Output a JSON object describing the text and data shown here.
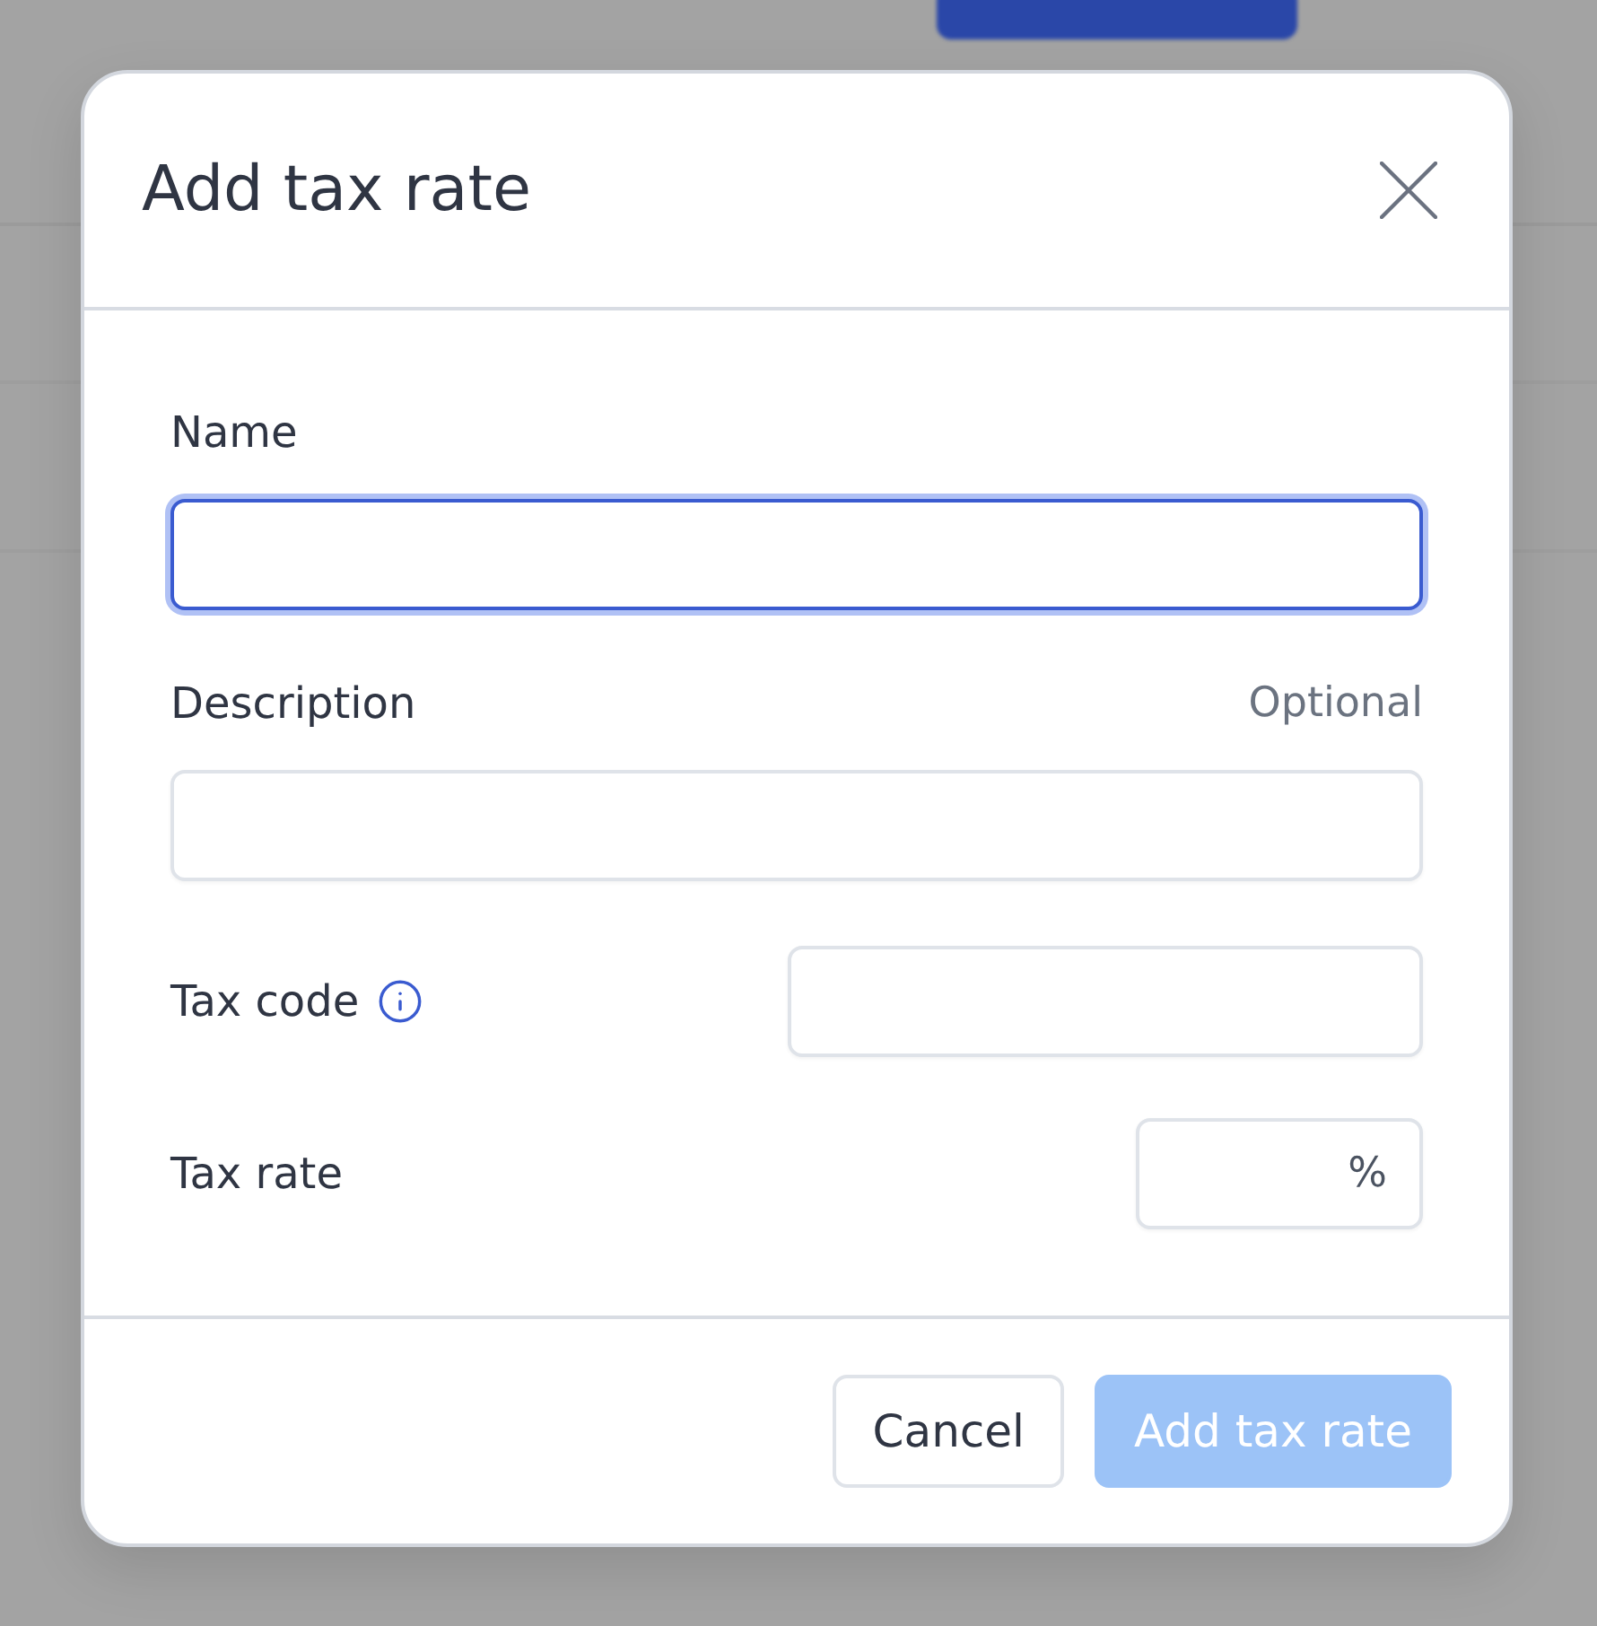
{
  "dialog": {
    "title": "Add tax rate",
    "fields": [
      {
        "kind": "stacked",
        "label": "Name",
        "focused": true
      },
      {
        "kind": "stacked",
        "label": "Description",
        "hint": "Optional",
        "focused": false
      },
      {
        "kind": "inline",
        "label": "Tax code",
        "info": true,
        "focused": false
      },
      {
        "kind": "percent",
        "label": "Tax rate",
        "suffix": "%",
        "focused": false
      }
    ],
    "buttons": [
      {
        "label": "Cancel",
        "kind": "secondary",
        "disabled": false
      },
      {
        "label": "Add tax rate",
        "kind": "primary",
        "disabled": true
      }
    ]
  }
}
